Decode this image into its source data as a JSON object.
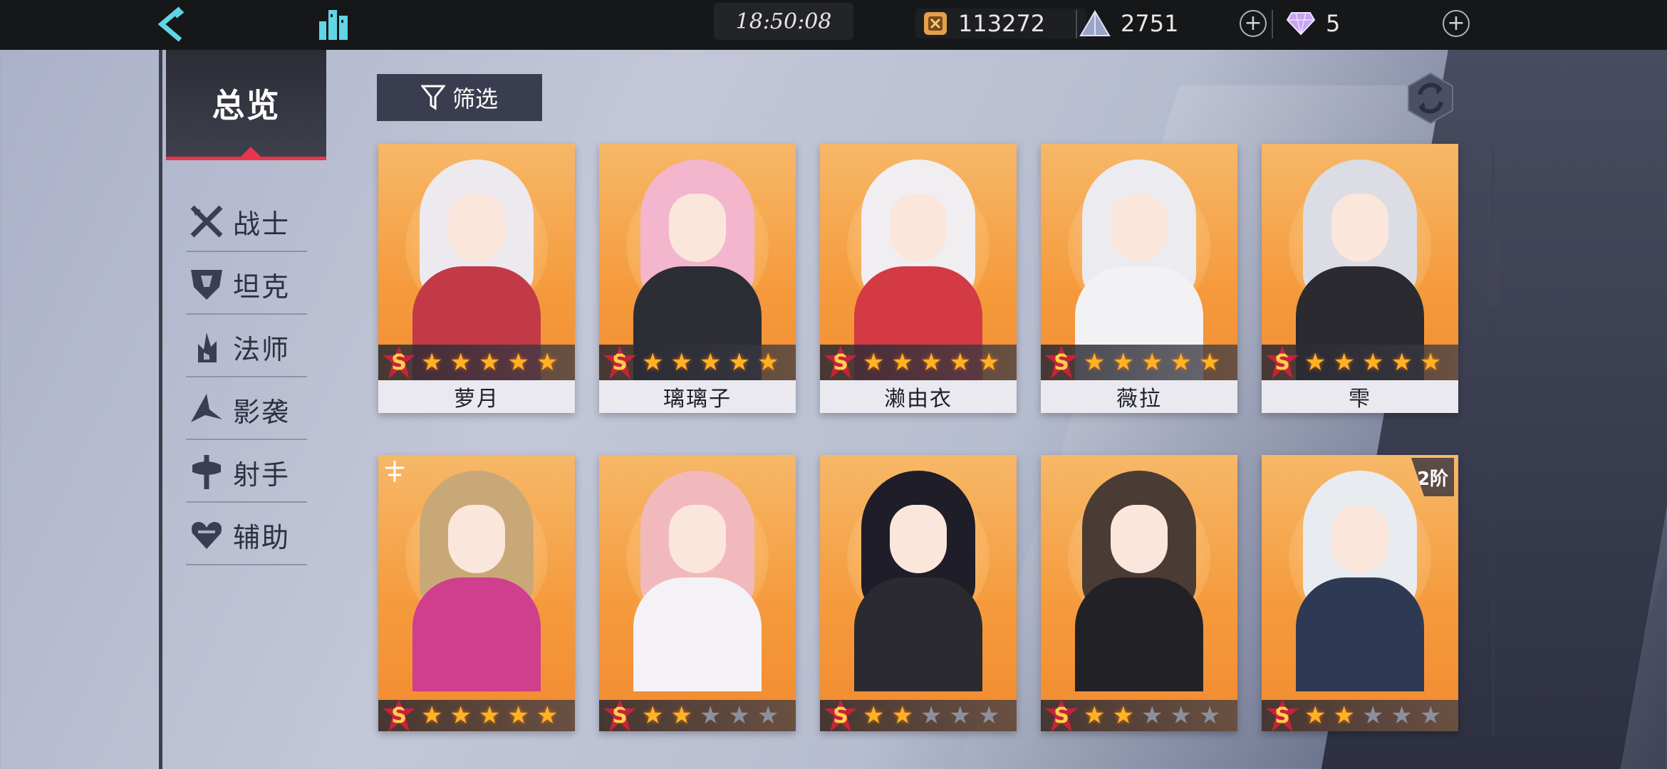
{
  "topbar": {
    "time": "18:50:08",
    "resources": [
      {
        "icon": "gold-coin-icon",
        "value": "113272"
      },
      {
        "icon": "crystal-pyramid-icon",
        "value": "2751"
      },
      {
        "icon": "diamond-gem-icon",
        "value": "5"
      }
    ]
  },
  "nav": {
    "active": "总览",
    "items": [
      {
        "icon": "crossed-swords-icon",
        "label": "战士"
      },
      {
        "icon": "shield-icon",
        "label": "坦克"
      },
      {
        "icon": "flame-staff-icon",
        "label": "法师"
      },
      {
        "icon": "shadow-blade-icon",
        "label": "影袭"
      },
      {
        "icon": "crosshair-icon",
        "label": "射手"
      },
      {
        "icon": "heart-icon",
        "label": "辅助"
      }
    ]
  },
  "filter": {
    "label": "筛选"
  },
  "characters": [
    {
      "name": "萝月",
      "rarity": "S",
      "stars": 5,
      "hair": "#ece9ef",
      "outfit": "#c23a48"
    },
    {
      "name": "璃璃子",
      "rarity": "S",
      "stars": 5,
      "hair": "#f3b6cc",
      "outfit": "#2d2d36"
    },
    {
      "name": "濑由衣",
      "rarity": "S",
      "stars": 5,
      "hair": "#f1eef2",
      "outfit": "#d33a43"
    },
    {
      "name": "薇拉",
      "rarity": "S",
      "stars": 5,
      "hair": "#ecebef",
      "outfit": "#f2f2f4"
    },
    {
      "name": "雫",
      "rarity": "S",
      "stars": 5,
      "hair": "#dcdde4",
      "outfit": "#2a2a30"
    },
    {
      "name": "",
      "rarity": "S",
      "stars": 5,
      "hair": "#c9a878",
      "outfit": "#d03e8e",
      "corner": "cross-emblem-icon"
    },
    {
      "name": "",
      "rarity": "S",
      "stars": 2,
      "hair": "#f2b9bd",
      "outfit": "#f4f2f7"
    },
    {
      "name": "",
      "rarity": "S",
      "stars": 2,
      "hair": "#1f1d28",
      "outfit": "#2b2a30"
    },
    {
      "name": "",
      "rarity": "S",
      "stars": 2,
      "hair": "#4a3b34",
      "outfit": "#222226"
    },
    {
      "name": "",
      "rarity": "S",
      "stars": 2,
      "hair": "#e8ebef",
      "outfit": "#2e3a54",
      "tier": "2阶"
    }
  ],
  "colors": {
    "accent": "#e8354b",
    "card_bg": "#f5a54a",
    "star_on": "#ffb226",
    "star_off": "#8d8f9e"
  }
}
